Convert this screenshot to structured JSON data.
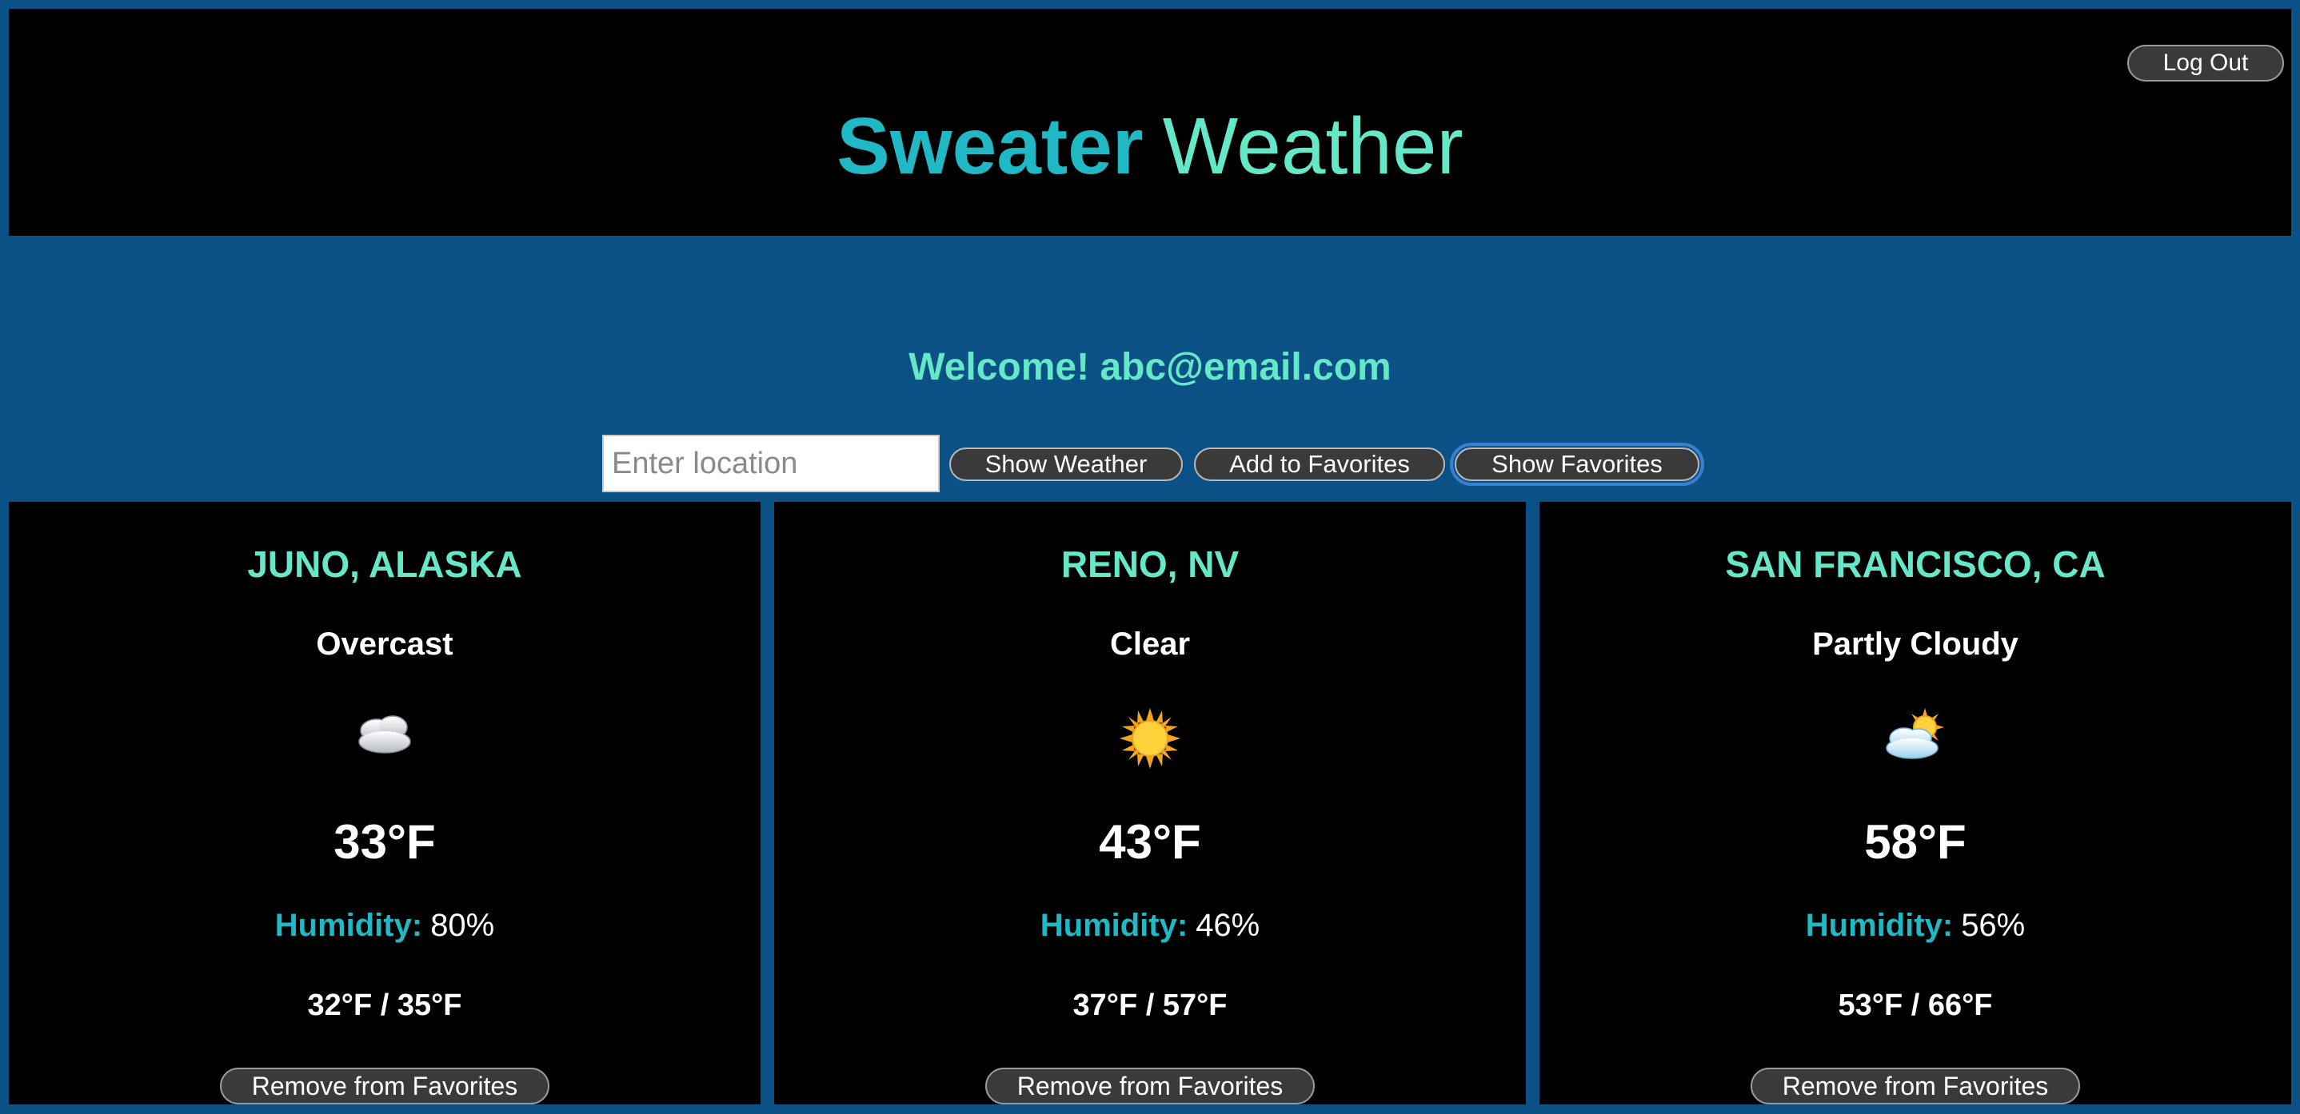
{
  "header": {
    "title_bold": "Sweater",
    "title_light": "Weather",
    "logout_label": "Log Out"
  },
  "welcome_text": "Welcome! abc@email.com",
  "search": {
    "placeholder": "Enter location",
    "value": "",
    "show_weather_label": "Show Weather",
    "add_favorites_label": "Add to Favorites",
    "show_favorites_label": "Show Favorites"
  },
  "favorites": [
    {
      "city": "JUNO, ALASKA",
      "condition": "Overcast",
      "icon": "cloud-icon",
      "temperature": "33°F",
      "humidity_label": "Humidity:",
      "humidity": "80%",
      "low_high": "32°F / 35°F",
      "remove_label": "Remove from Favorites"
    },
    {
      "city": "RENO, NV",
      "condition": "Clear",
      "icon": "sun-icon",
      "temperature": "43°F",
      "humidity_label": "Humidity:",
      "humidity": "46%",
      "low_high": "37°F / 57°F",
      "remove_label": "Remove from Favorites"
    },
    {
      "city": "SAN FRANCISCO, CA",
      "condition": "Partly Cloudy",
      "icon": "sun-behind-cloud-icon",
      "temperature": "58°F",
      "humidity_label": "Humidity:",
      "humidity": "56%",
      "low_high": "53°F / 66°F",
      "remove_label": "Remove from Favorites"
    }
  ],
  "colors": {
    "page_background": "#0b5185",
    "panel_background": "#000000",
    "accent_teal": "#1fb8c4",
    "accent_mint": "#64e8c8",
    "button_background": "#3a3a3a",
    "focus_ring": "#3b7fd0"
  }
}
